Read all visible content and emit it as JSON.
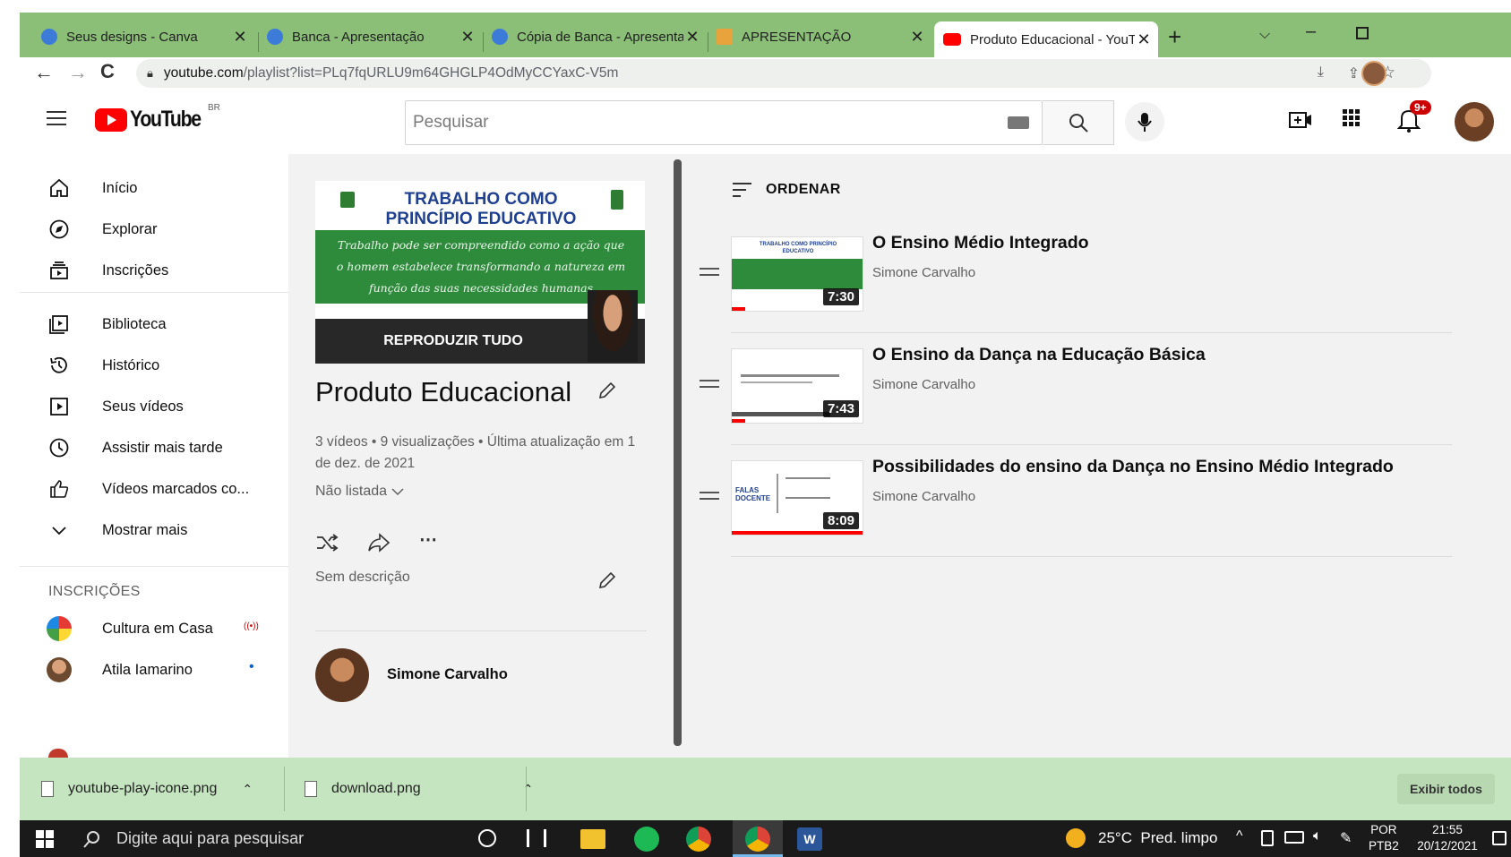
{
  "browser": {
    "tabs": [
      {
        "title": "Seus designs - Canva",
        "favicon_color": "#3d7bd8",
        "active": false
      },
      {
        "title": "Banca - Apresentação",
        "favicon_color": "#3d7bd8",
        "active": false
      },
      {
        "title": "Cópia de Banca - Apresenta",
        "favicon_color": "#3d7bd8",
        "active": false
      },
      {
        "title": "APRESENTAÇÃO",
        "favicon_color": "#e8a33d",
        "active": false
      },
      {
        "title": "Produto Educacional - YouTu",
        "favicon_color": "#ff0000",
        "active": true
      }
    ],
    "new_tab_label": "+",
    "url_host": "youtube.com",
    "url_path": "/playlist?list=PLq7fqURLU9m64GHGLP4OdMyCCYaxC-V5m",
    "tab_strip_color": "#8bbf78"
  },
  "youtube": {
    "logo_text": "YouTube",
    "country_code": "BR",
    "search_placeholder": "Pesquisar",
    "notification_count": "9+",
    "brand_color": "#ff0000"
  },
  "sidebar": {
    "main_items": [
      {
        "label": "Início",
        "icon": "home-icon"
      },
      {
        "label": "Explorar",
        "icon": "compass-icon"
      },
      {
        "label": "Inscrições",
        "icon": "subscriptions-icon"
      }
    ],
    "library_items": [
      {
        "label": "Biblioteca",
        "icon": "library-icon"
      },
      {
        "label": "Histórico",
        "icon": "history-icon"
      },
      {
        "label": "Seus vídeos",
        "icon": "your-videos-icon"
      },
      {
        "label": "Assistir mais tarde",
        "icon": "watch-later-icon"
      },
      {
        "label": "Vídeos marcados co...",
        "icon": "thumbs-up-icon"
      },
      {
        "label": "Mostrar mais",
        "icon": "chevron-down-icon"
      }
    ],
    "subscriptions_heading": "INSCRIÇÕES",
    "subscriptions": [
      {
        "label": "Cultura em Casa",
        "indicator": "live",
        "indicator_text": "((•))"
      },
      {
        "label": "Atila Iamarino",
        "indicator": "new",
        "indicator_text": "•"
      }
    ]
  },
  "playlist": {
    "cover_title": "TRABALHO COMO PRINCÍPIO EDUCATIVO",
    "cover_text": "Trabalho pode ser compreendido como a ação que o homem estabelece transformando a natureza em função das suas necessidades humanas",
    "play_all_label": "REPRODUZIR TUDO",
    "title": "Produto Educacional",
    "stats": "3 vídeos • 9 visualizações • Última atualização em 1 de dez. de 2021",
    "privacy": "Não listada",
    "description": "Sem descrição",
    "owner": "Simone Carvalho"
  },
  "videos_list": {
    "sort_label": "ORDENAR",
    "videos": [
      {
        "title": "O Ensino Médio Integrado",
        "channel": "Simone Carvalho",
        "duration": "7:30",
        "progress": 0.1,
        "thumb_caption": "TRABALHO COMO PRINCÍPIO EDUCATIVO"
      },
      {
        "title": "O Ensino da Dança na Educação Básica",
        "channel": "Simone Carvalho",
        "duration": "7:43",
        "progress": 0.1,
        "thumb_caption": ""
      },
      {
        "title": "Possibilidades do ensino da Dança no Ensino Médio Integrado",
        "channel": "Simone Carvalho",
        "duration": "8:09",
        "progress": 1.0,
        "thumb_caption": "FALAS DOCENTE"
      }
    ]
  },
  "downloads": {
    "items": [
      {
        "filename": "youtube-play-icone.png"
      },
      {
        "filename": "download.png"
      }
    ],
    "show_all_label": "Exibir todos"
  },
  "taskbar": {
    "search_placeholder": "Digite aqui para pesquisar",
    "weather": "25°C  Pred. limpo",
    "language": "POR",
    "layout": "PTB2",
    "time": "21:55",
    "date": "20/12/2021"
  }
}
